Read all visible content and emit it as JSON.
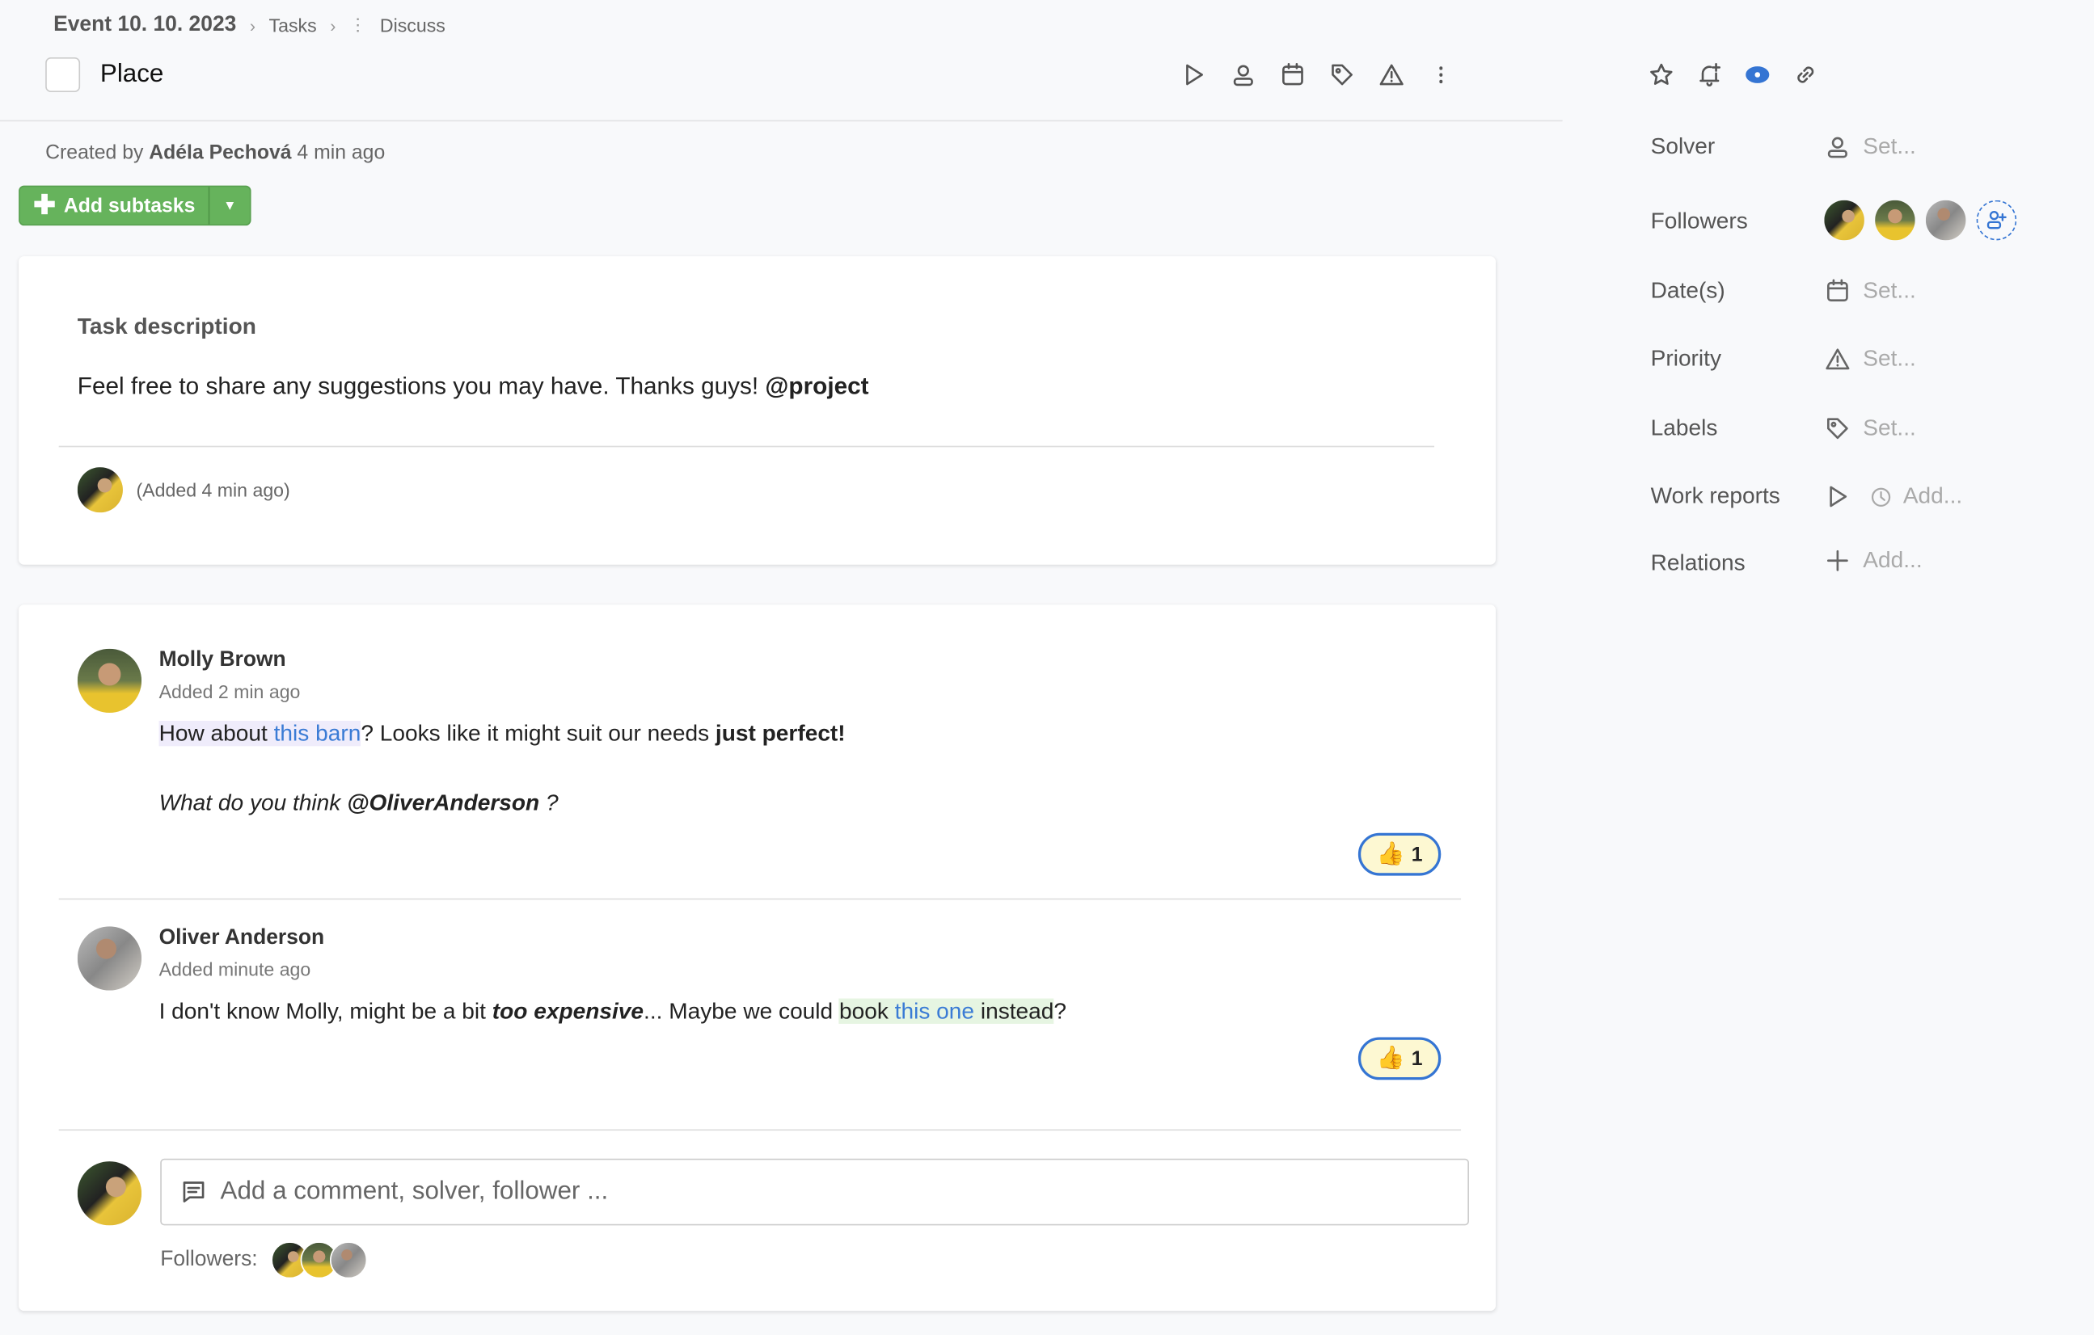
{
  "breadcrumb": [
    "Event 10. 10. 2023",
    "Tasks",
    "Discuss"
  ],
  "task": {
    "title": "Place",
    "created_prefix": "Created by",
    "creator": "Adéla Pechová",
    "created_when": "4 min ago"
  },
  "toolbar_icons": [
    "play-icon",
    "user-icon",
    "calendar-icon",
    "tag-icon",
    "warning-icon",
    "more-vertical-icon"
  ],
  "side_icons": [
    "star-icon",
    "bell-plus-icon",
    "eye-icon",
    "link-icon"
  ],
  "add_subtasks": "Add subtasks",
  "description": {
    "heading": "Task description",
    "text": "Feel free to share any suggestions you may have. Thanks guys!",
    "mention": "@project",
    "added": "(Added 4 min ago)"
  },
  "comments": [
    {
      "author": "Molly Brown",
      "when": "Added 2 min ago",
      "p1a": "How about ",
      "p1link": "this barn",
      "p1b": "? Looks like it might suit our needs ",
      "p1bold": "just perfect!",
      "p2": "What do you think ",
      "p2mention": "@OliverAnderson",
      "p2end": " ?",
      "reaction_count": "1"
    },
    {
      "author": "Oliver Anderson",
      "when": "Added minute ago",
      "a": "I don't know Molly, might be a bit ",
      "bold": "too expensive",
      "b": "... Maybe we could ",
      "hl1": "book ",
      "link": "this one",
      "hl2": " instead",
      "end": "?",
      "reaction_count": "1"
    }
  ],
  "composer": {
    "placeholder": "Add a comment, solver, follower ...",
    "followers_label": "Followers:"
  },
  "sidebar": {
    "solver": {
      "label": "Solver",
      "value": "Set..."
    },
    "followers": {
      "label": "Followers"
    },
    "dates": {
      "label": "Date(s)",
      "value": "Set..."
    },
    "priority": {
      "label": "Priority",
      "value": "Set..."
    },
    "labels": {
      "label": "Labels",
      "value": "Set..."
    },
    "work_reports": {
      "label": "Work reports",
      "value": "Add..."
    },
    "relations": {
      "label": "Relations",
      "value": "Add..."
    }
  },
  "colors": {
    "accent": "#3575d3",
    "green": "#66b35c",
    "reaction_bg": "#fdf8d2"
  }
}
